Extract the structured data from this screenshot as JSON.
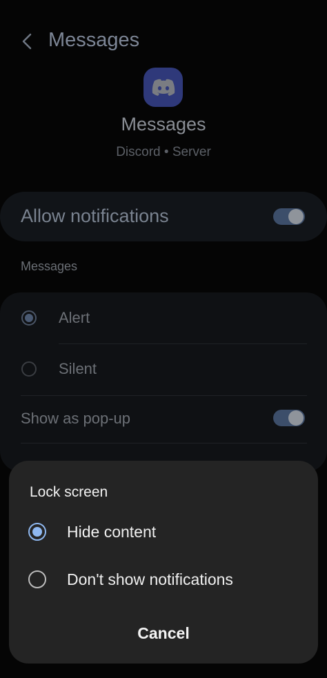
{
  "header": {
    "title": "Messages"
  },
  "app": {
    "name": "Messages",
    "subtitle": "Discord • Server"
  },
  "allow": {
    "label": "Allow notifications",
    "on": true
  },
  "section": {
    "label": "Messages"
  },
  "options": {
    "alert": {
      "label": "Alert",
      "selected": true
    },
    "silent": {
      "label": "Silent",
      "selected": false
    },
    "popup": {
      "label": "Show as pop-up",
      "on": true
    }
  },
  "sheet": {
    "title": "Lock screen",
    "options": [
      {
        "label": "Hide content",
        "selected": true
      },
      {
        "label": "Don't show notifications",
        "selected": false
      }
    ],
    "cancel_label": "Cancel"
  },
  "colors": {
    "accent": "#8fb8f0",
    "app_icon": "#4b5dc8",
    "sheet_bg": "#242424"
  }
}
